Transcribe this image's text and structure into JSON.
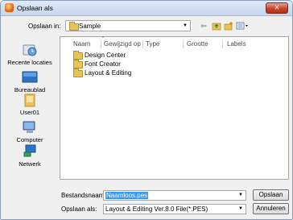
{
  "window": {
    "title": "Opslaan als",
    "close_label": "✕"
  },
  "toolbar": {
    "save_in_label": "Opslaan in:",
    "current_folder": "Sample",
    "back_icon": "back-arrow-icon",
    "up_icon": "up-folder-icon",
    "new_folder_icon": "new-folder-icon",
    "views_icon": "views-menu-icon"
  },
  "places": [
    {
      "label": "Recente locaties",
      "icon": "recent-locations-icon"
    },
    {
      "label": "Bureaublad",
      "icon": "desktop-icon"
    },
    {
      "label": "User01",
      "icon": "user-folder-icon"
    },
    {
      "label": "Computer",
      "icon": "computer-icon"
    },
    {
      "label": "Netwerk",
      "icon": "network-icon"
    }
  ],
  "columns": [
    "Naam",
    "Gewijzigd op",
    "Type",
    "Grootte",
    "Labels"
  ],
  "files": [
    {
      "name": "Design Center"
    },
    {
      "name": "Font Creator"
    },
    {
      "name": "Layout & Editing"
    }
  ],
  "footer": {
    "filename_label": "Bestandsnaam:",
    "filename_value": "Naamloos.pes",
    "save_as_label": "Opslaan als:",
    "save_as_value": "Layout & Editing Ver.8.0 File(*.PES)",
    "save_button": "Opslaan",
    "cancel_button": "Annuleren"
  },
  "colors": {
    "accent": "#3399ff",
    "close": "#c4452c",
    "folder": "#e6c45a"
  }
}
